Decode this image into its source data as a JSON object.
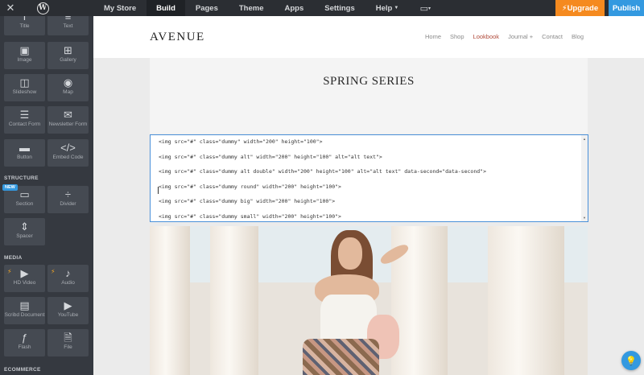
{
  "topbar": {
    "close_icon": "close-icon",
    "logo_letter": "W",
    "nav": [
      {
        "label": "My Store"
      },
      {
        "label": "Build"
      },
      {
        "label": "Pages"
      },
      {
        "label": "Theme"
      },
      {
        "label": "Apps"
      },
      {
        "label": "Settings"
      },
      {
        "label": "Help"
      }
    ],
    "active_tab": "Build",
    "upgrade_label": "Upgrade",
    "publish_label": "Publish",
    "colors": {
      "upgrade": "#f58a1f",
      "publish": "#3399e0"
    }
  },
  "sidebar": {
    "basic": [
      {
        "label": "Title",
        "icon": "title-icon"
      },
      {
        "label": "Text",
        "icon": "text-icon"
      },
      {
        "label": "Image",
        "icon": "image-icon"
      },
      {
        "label": "Gallery",
        "icon": "gallery-icon"
      },
      {
        "label": "Slideshow",
        "icon": "slideshow-icon"
      },
      {
        "label": "Map",
        "icon": "map-pin-icon"
      },
      {
        "label": "Contact Form",
        "icon": "contact-form-icon"
      },
      {
        "label": "Newsletter Form",
        "icon": "newsletter-icon"
      },
      {
        "label": "Button",
        "icon": "button-icon"
      },
      {
        "label": "Embed Code",
        "icon": "embed-code-icon"
      }
    ],
    "structure_heading": "STRUCTURE",
    "new_badge": "NEW",
    "structure": [
      {
        "label": "Section",
        "icon": "section-icon"
      },
      {
        "label": "Divider",
        "icon": "divider-icon"
      },
      {
        "label": "Spacer",
        "icon": "spacer-icon"
      }
    ],
    "media_heading": "MEDIA",
    "media": [
      {
        "label": "HD Video",
        "icon": "video-icon"
      },
      {
        "label": "Audio",
        "icon": "audio-icon"
      },
      {
        "label": "Scribd Document",
        "icon": "document-icon"
      },
      {
        "label": "YouTube",
        "icon": "youtube-icon"
      },
      {
        "label": "Flash",
        "icon": "flash-icon"
      },
      {
        "label": "File",
        "icon": "file-icon"
      }
    ],
    "ecommerce_heading": "ECOMMERCE"
  },
  "site": {
    "brand": "AVENUE",
    "nav": [
      "Home",
      "Shop",
      "Lookbook",
      "Journal +",
      "Contact",
      "Blog"
    ],
    "active_nav": "Lookbook",
    "hero_title": "SPRING SERIES",
    "code_lines": [
      "<img src=\"#\" class=\"dummy\" width=\"200\" height=\"100\">",
      "<img src=\"#\" class=\"dummy alt\" width=\"200\" height=\"100\" alt=\"alt text\">",
      "<img src=\"#\" class=\"dummy alt double\" width=\"200\" height=\"100\" alt=\"alt text\" data-second=\"data-second\">",
      "<img src=\"#\" class=\"dummy round\" width=\"200\" height=\"100\">",
      "<img src=\"#\" class=\"dummy big\" width=\"200\" height=\"100\">",
      "<img src=\"#\" class=\"dummy small\" width=\"200\" height=\"100\">"
    ]
  },
  "help_icon": "lightbulb-icon"
}
